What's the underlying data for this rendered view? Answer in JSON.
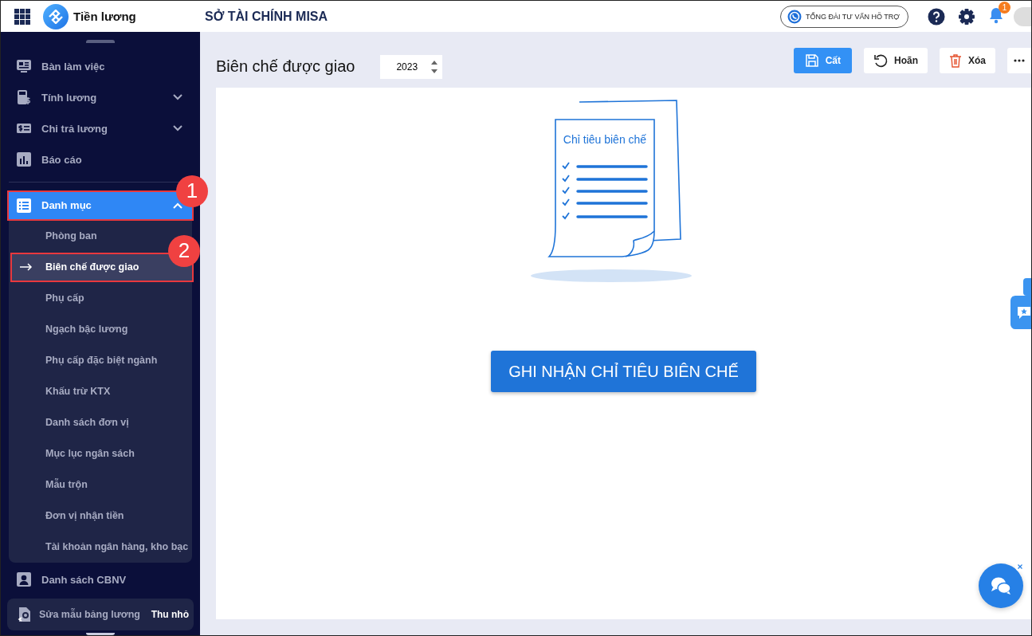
{
  "header": {
    "app_name": "Tiền lương",
    "org_name": "SỞ TÀI CHÍNH MISA",
    "hotline": "TỔNG ĐÀI TƯ VẤN HỖ TRỢ",
    "notification_count": "1"
  },
  "sidebar": {
    "items": [
      {
        "label": "Bàn làm việc",
        "kind": "item",
        "selected": false
      },
      {
        "label": "Tính lương",
        "kind": "group",
        "expanded": false,
        "selected": false
      },
      {
        "label": "Chi trả lương",
        "kind": "group",
        "expanded": false,
        "selected": false
      },
      {
        "label": "Báo cáo",
        "kind": "item",
        "selected": false
      },
      {
        "label": "Danh mục",
        "kind": "group",
        "expanded": true,
        "selected": true,
        "annotation": "1",
        "children": [
          {
            "label": "Phòng ban",
            "selected": false
          },
          {
            "label": "Biên chế được giao",
            "selected": true,
            "annotation": "2"
          },
          {
            "label": "Phụ cấp",
            "selected": false
          },
          {
            "label": "Ngạch bậc lương",
            "selected": false
          },
          {
            "label": "Phụ cấp đặc biệt ngành",
            "selected": false
          },
          {
            "label": "Khấu trừ KTX",
            "selected": false
          },
          {
            "label": "Danh sách đơn vị",
            "selected": false
          },
          {
            "label": "Mục lục ngân sách",
            "selected": false
          },
          {
            "label": "Mẫu trộn",
            "selected": false
          },
          {
            "label": "Đơn vị nhận tiền",
            "selected": false
          },
          {
            "label": "Tài khoản ngân hàng, kho bạc",
            "selected": false
          }
        ]
      },
      {
        "label": "Danh sách CBNV",
        "kind": "item",
        "selected": false
      },
      {
        "label": "Sửa mẫu bảng lương",
        "kind": "panel",
        "selected": false
      }
    ],
    "collapse_label": "Thu nhỏ"
  },
  "page": {
    "title": "Biên chế được giao",
    "year": "2023",
    "toolbar": [
      {
        "kind": "save",
        "label": "Cất"
      },
      {
        "kind": "undo",
        "label": "Hoãn"
      },
      {
        "kind": "delete",
        "label": "Xóa"
      },
      {
        "kind": "more"
      }
    ],
    "empty_state": {
      "illustration_title": "Chỉ tiêu biên chế",
      "action": "GHI NHẬN CHỈ TIÊU BIÊN CHẾ"
    }
  }
}
